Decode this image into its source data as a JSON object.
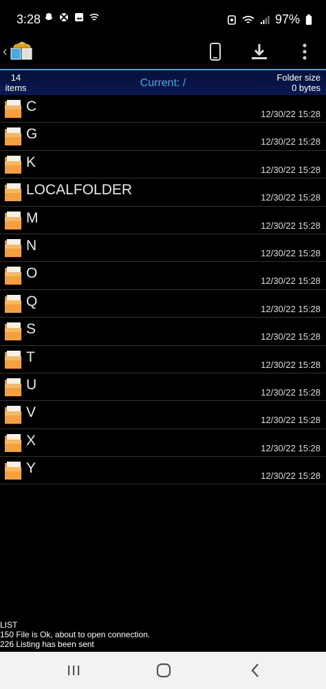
{
  "status_bar": {
    "time": "3:28",
    "battery": "97%",
    "icons": [
      "snapchat-icon",
      "xbox-icon",
      "gallery-icon",
      "wifi-shield-icon",
      "alarm-icon",
      "wifi-icon",
      "signal-icon",
      "battery-icon"
    ]
  },
  "toolbar": {
    "icons": [
      "back-chevron-icon",
      "app-logo-icon",
      "phone-icon",
      "download-icon",
      "more-vert-icon"
    ]
  },
  "info": {
    "items_count": "14",
    "items_label": "items",
    "current": "Current: /",
    "folder_size_label": "Folder size",
    "folder_size_value": "0 bytes"
  },
  "files": [
    {
      "name": "C",
      "date": "12/30/22 15:28"
    },
    {
      "name": "G",
      "date": "12/30/22 15:28"
    },
    {
      "name": "K",
      "date": "12/30/22 15:28"
    },
    {
      "name": "LOCALFOLDER",
      "date": "12/30/22 15:28"
    },
    {
      "name": "M",
      "date": "12/30/22 15:28"
    },
    {
      "name": "N",
      "date": "12/30/22 15:28"
    },
    {
      "name": "O",
      "date": "12/30/22 15:28"
    },
    {
      "name": "Q",
      "date": "12/30/22 15:28"
    },
    {
      "name": "S",
      "date": "12/30/22 15:28"
    },
    {
      "name": "T",
      "date": "12/30/22 15:28"
    },
    {
      "name": "U",
      "date": "12/30/22 15:28"
    },
    {
      "name": "V",
      "date": "12/30/22 15:28"
    },
    {
      "name": "X",
      "date": "12/30/22 15:28"
    },
    {
      "name": "Y",
      "date": "12/30/22 15:28"
    }
  ],
  "log": [
    "LIST",
    "150 File is Ok, about to open connection.",
    "226 Listing has been sent"
  ],
  "colors": {
    "accent": "#4aa8e0",
    "folder": "#f08a30",
    "header_bg": "#0a1850"
  }
}
